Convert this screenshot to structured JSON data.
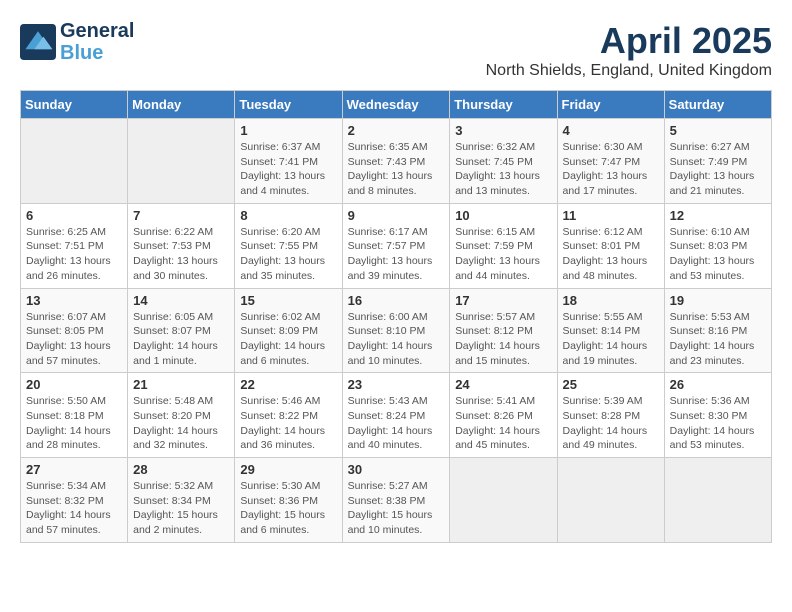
{
  "header": {
    "logo_line1": "General",
    "logo_line2": "Blue",
    "month_title": "April 2025",
    "location": "North Shields, England, United Kingdom"
  },
  "columns": [
    "Sunday",
    "Monday",
    "Tuesday",
    "Wednesday",
    "Thursday",
    "Friday",
    "Saturday"
  ],
  "weeks": [
    [
      {
        "day": "",
        "info": ""
      },
      {
        "day": "",
        "info": ""
      },
      {
        "day": "1",
        "info": "Sunrise: 6:37 AM\nSunset: 7:41 PM\nDaylight: 13 hours and 4 minutes."
      },
      {
        "day": "2",
        "info": "Sunrise: 6:35 AM\nSunset: 7:43 PM\nDaylight: 13 hours and 8 minutes."
      },
      {
        "day": "3",
        "info": "Sunrise: 6:32 AM\nSunset: 7:45 PM\nDaylight: 13 hours and 13 minutes."
      },
      {
        "day": "4",
        "info": "Sunrise: 6:30 AM\nSunset: 7:47 PM\nDaylight: 13 hours and 17 minutes."
      },
      {
        "day": "5",
        "info": "Sunrise: 6:27 AM\nSunset: 7:49 PM\nDaylight: 13 hours and 21 minutes."
      }
    ],
    [
      {
        "day": "6",
        "info": "Sunrise: 6:25 AM\nSunset: 7:51 PM\nDaylight: 13 hours and 26 minutes."
      },
      {
        "day": "7",
        "info": "Sunrise: 6:22 AM\nSunset: 7:53 PM\nDaylight: 13 hours and 30 minutes."
      },
      {
        "day": "8",
        "info": "Sunrise: 6:20 AM\nSunset: 7:55 PM\nDaylight: 13 hours and 35 minutes."
      },
      {
        "day": "9",
        "info": "Sunrise: 6:17 AM\nSunset: 7:57 PM\nDaylight: 13 hours and 39 minutes."
      },
      {
        "day": "10",
        "info": "Sunrise: 6:15 AM\nSunset: 7:59 PM\nDaylight: 13 hours and 44 minutes."
      },
      {
        "day": "11",
        "info": "Sunrise: 6:12 AM\nSunset: 8:01 PM\nDaylight: 13 hours and 48 minutes."
      },
      {
        "day": "12",
        "info": "Sunrise: 6:10 AM\nSunset: 8:03 PM\nDaylight: 13 hours and 53 minutes."
      }
    ],
    [
      {
        "day": "13",
        "info": "Sunrise: 6:07 AM\nSunset: 8:05 PM\nDaylight: 13 hours and 57 minutes."
      },
      {
        "day": "14",
        "info": "Sunrise: 6:05 AM\nSunset: 8:07 PM\nDaylight: 14 hours and 1 minute."
      },
      {
        "day": "15",
        "info": "Sunrise: 6:02 AM\nSunset: 8:09 PM\nDaylight: 14 hours and 6 minutes."
      },
      {
        "day": "16",
        "info": "Sunrise: 6:00 AM\nSunset: 8:10 PM\nDaylight: 14 hours and 10 minutes."
      },
      {
        "day": "17",
        "info": "Sunrise: 5:57 AM\nSunset: 8:12 PM\nDaylight: 14 hours and 15 minutes."
      },
      {
        "day": "18",
        "info": "Sunrise: 5:55 AM\nSunset: 8:14 PM\nDaylight: 14 hours and 19 minutes."
      },
      {
        "day": "19",
        "info": "Sunrise: 5:53 AM\nSunset: 8:16 PM\nDaylight: 14 hours and 23 minutes."
      }
    ],
    [
      {
        "day": "20",
        "info": "Sunrise: 5:50 AM\nSunset: 8:18 PM\nDaylight: 14 hours and 28 minutes."
      },
      {
        "day": "21",
        "info": "Sunrise: 5:48 AM\nSunset: 8:20 PM\nDaylight: 14 hours and 32 minutes."
      },
      {
        "day": "22",
        "info": "Sunrise: 5:46 AM\nSunset: 8:22 PM\nDaylight: 14 hours and 36 minutes."
      },
      {
        "day": "23",
        "info": "Sunrise: 5:43 AM\nSunset: 8:24 PM\nDaylight: 14 hours and 40 minutes."
      },
      {
        "day": "24",
        "info": "Sunrise: 5:41 AM\nSunset: 8:26 PM\nDaylight: 14 hours and 45 minutes."
      },
      {
        "day": "25",
        "info": "Sunrise: 5:39 AM\nSunset: 8:28 PM\nDaylight: 14 hours and 49 minutes."
      },
      {
        "day": "26",
        "info": "Sunrise: 5:36 AM\nSunset: 8:30 PM\nDaylight: 14 hours and 53 minutes."
      }
    ],
    [
      {
        "day": "27",
        "info": "Sunrise: 5:34 AM\nSunset: 8:32 PM\nDaylight: 14 hours and 57 minutes."
      },
      {
        "day": "28",
        "info": "Sunrise: 5:32 AM\nSunset: 8:34 PM\nDaylight: 15 hours and 2 minutes."
      },
      {
        "day": "29",
        "info": "Sunrise: 5:30 AM\nSunset: 8:36 PM\nDaylight: 15 hours and 6 minutes."
      },
      {
        "day": "30",
        "info": "Sunrise: 5:27 AM\nSunset: 8:38 PM\nDaylight: 15 hours and 10 minutes."
      },
      {
        "day": "",
        "info": ""
      },
      {
        "day": "",
        "info": ""
      },
      {
        "day": "",
        "info": ""
      }
    ]
  ]
}
